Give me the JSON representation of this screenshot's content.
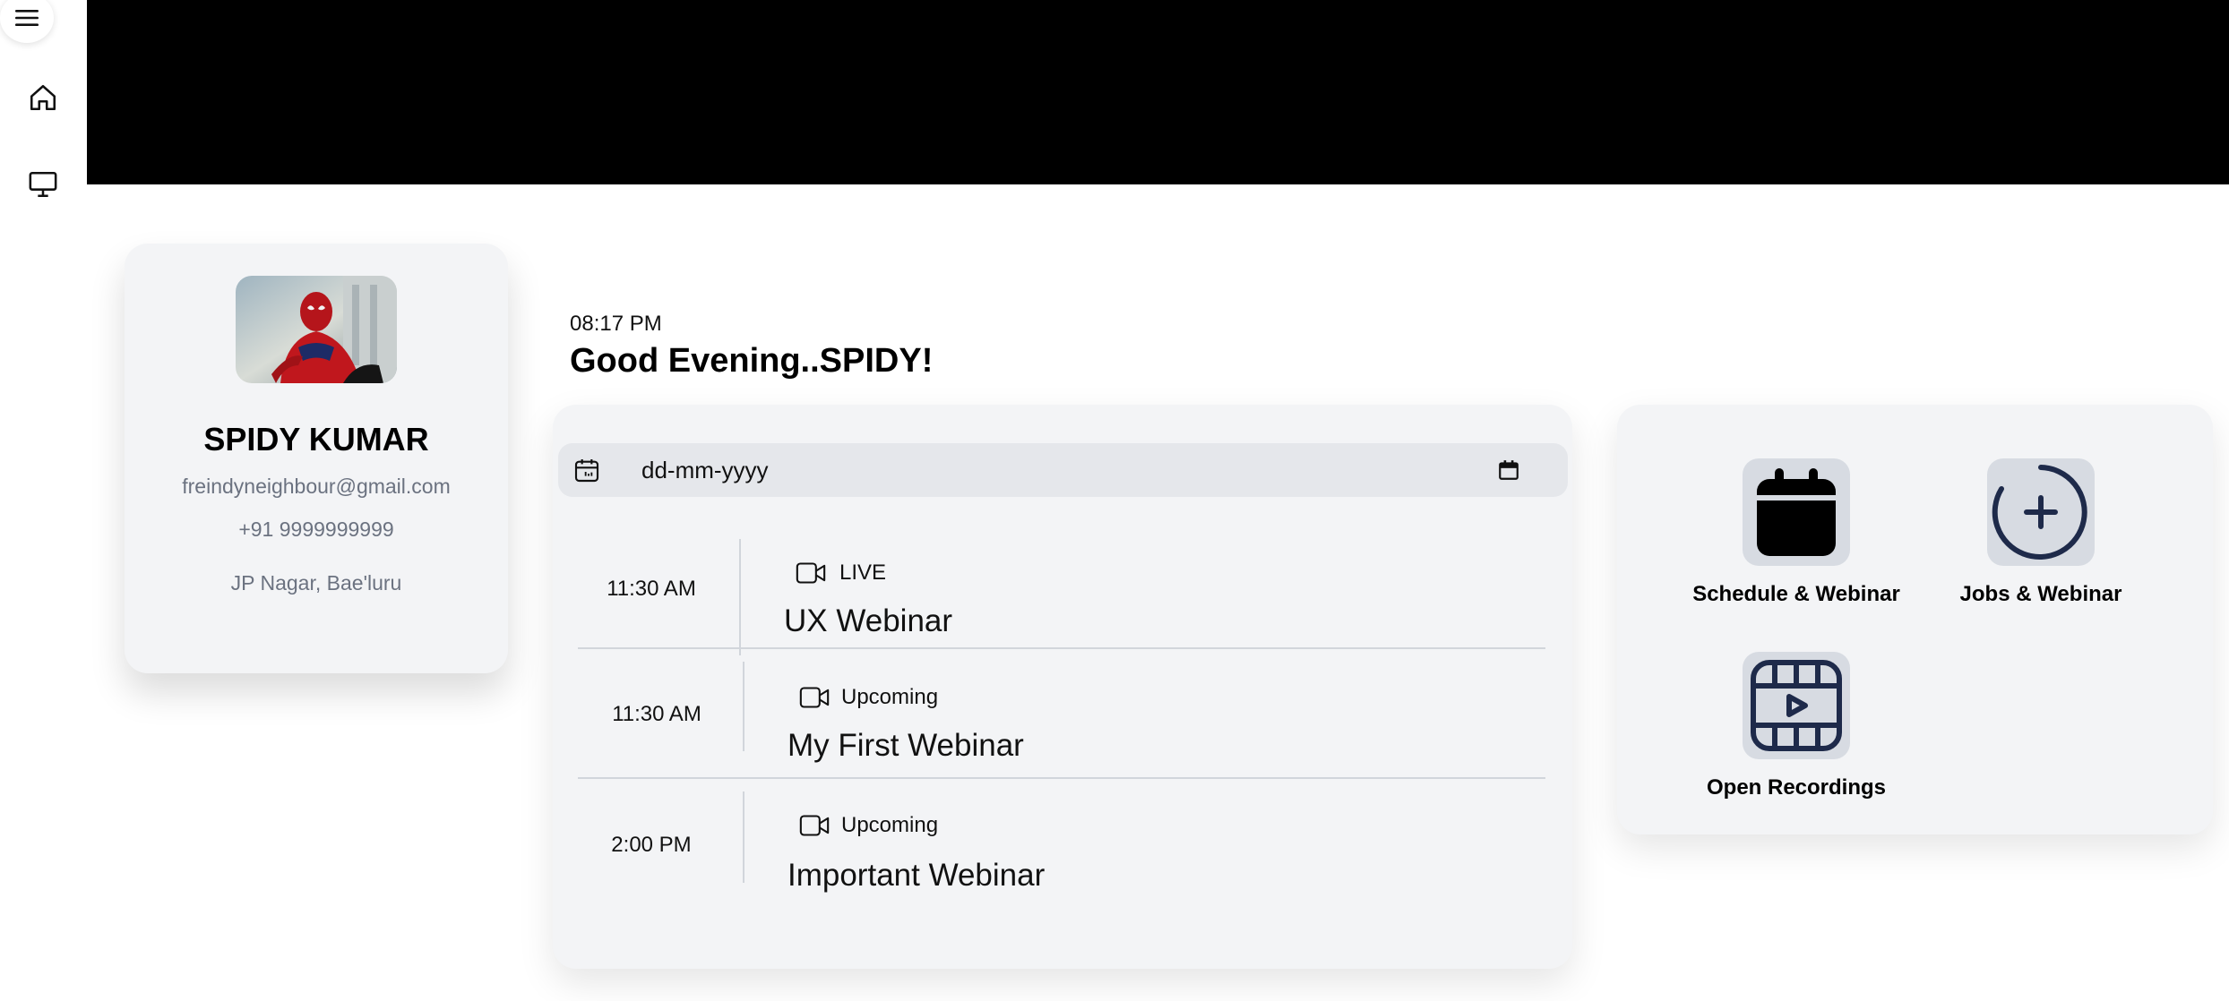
{
  "sidebar": {
    "icons": [
      "menu-icon",
      "home-icon",
      "monitor-icon"
    ]
  },
  "profile": {
    "name": "SPIDY KUMAR",
    "email": "freindyneighbour@gmail.com",
    "phone": "+91 9999999999",
    "location": "JP Nagar, Bae'luru"
  },
  "header": {
    "time": "08:17 PM",
    "greeting": "Good Evening..SPIDY!"
  },
  "date_filter": {
    "value": "dd-mm-yyyy"
  },
  "webinars": [
    {
      "time": "11:30 AM",
      "status": "LIVE",
      "title": "UX Webinar"
    },
    {
      "time": "11:30 AM",
      "status": "Upcoming",
      "title": "My First Webinar"
    },
    {
      "time": "2:00 PM",
      "status": "Upcoming",
      "title": "Important Webinar"
    }
  ],
  "actions": [
    {
      "label": "Schedule & Webinar",
      "icon": "calendar-icon"
    },
    {
      "label": "Jobs & Webinar",
      "icon": "plus-circle-icon"
    },
    {
      "label": "Open Recordings",
      "icon": "film-play-icon"
    }
  ],
  "colors": {
    "banner": "#000000",
    "card_background": "#f3f4f6",
    "icon_navy": "#1e2a4a",
    "muted_text": "#6b7280"
  }
}
